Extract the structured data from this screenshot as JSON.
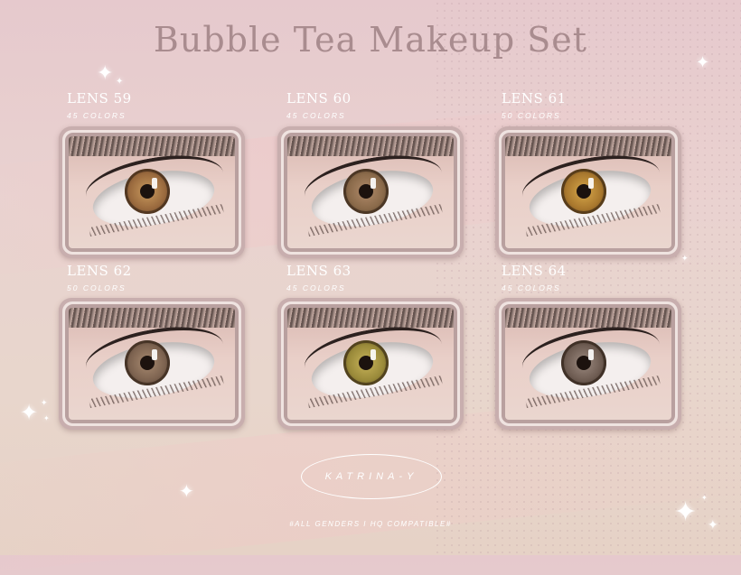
{
  "title": "Bubble Tea Makeup Set",
  "lenses": [
    {
      "label": "LENS 59",
      "colors": "45 COLORS",
      "iris_color": "#9a6a3e"
    },
    {
      "label": "LENS 60",
      "colors": "45 COLORS",
      "iris_color": "#8a6a4a"
    },
    {
      "label": "LENS 61",
      "colors": "50 COLORS",
      "iris_color": "#a9782e"
    },
    {
      "label": "LENS 62",
      "colors": "50 COLORS",
      "iris_color": "#7d6350"
    },
    {
      "label": "LENS 63",
      "colors": "45 COLORS",
      "iris_color": "#9a8a3a"
    },
    {
      "label": "LENS 64",
      "colors": "45 COLORS",
      "iris_color": "#6e5c52"
    }
  ],
  "brand": "KATRINA-Y",
  "footer": "#ALL GENDERS I HQ COMPATIBLE#",
  "colors": {
    "title": "#a98c8f",
    "frame": "#c8aeae",
    "text": "#ffffff"
  }
}
